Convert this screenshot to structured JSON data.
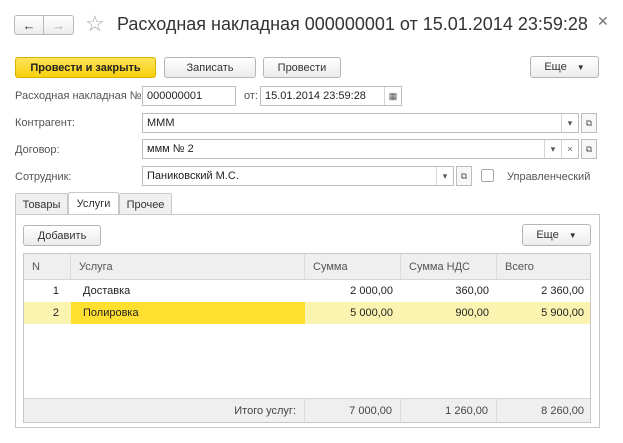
{
  "window": {
    "title": "Расходная накладная 000000001 от 15.01.2014 23:59:28"
  },
  "toolbar": {
    "post_and_close": "Провести и закрыть",
    "save": "Записать",
    "post": "Провести",
    "more": "Еще"
  },
  "header": {
    "doc_number_label": "Расходная накладная №:",
    "doc_number": "000000001",
    "date_label": "от:",
    "date": "15.01.2014 23:59:28",
    "counterparty_label": "Контрагент:",
    "counterparty": "МММ",
    "contract_label": "Договор:",
    "contract": "ммм № 2",
    "employee_label": "Сотрудник:",
    "employee": "Паниковский М.С.",
    "management_label": "Управленческий",
    "management_checked": false
  },
  "tabs": [
    {
      "label": "Товары",
      "active": false
    },
    {
      "label": "Услуги",
      "active": true
    },
    {
      "label": "Прочее",
      "active": false
    }
  ],
  "services": {
    "add_button": "Добавить",
    "more": "Еще",
    "columns": [
      "N",
      "Услуга",
      "Сумма",
      "Сумма НДС",
      "Всего"
    ],
    "rows": [
      {
        "n": "1",
        "service": "Доставка",
        "sum": "2 000,00",
        "vat": "360,00",
        "total": "2 360,00"
      },
      {
        "n": "2",
        "service": "Полировка",
        "sum": "5 000,00",
        "vat": "900,00",
        "total": "5 900,00"
      }
    ],
    "footer": {
      "label": "Итого услуг:",
      "sum": "7 000,00",
      "vat": "1 260,00",
      "total": "8 260,00"
    }
  },
  "colors": {
    "accent": "#f7cf0c",
    "selected_row": "#fbf3b0",
    "selected_cell": "#ffe030"
  }
}
